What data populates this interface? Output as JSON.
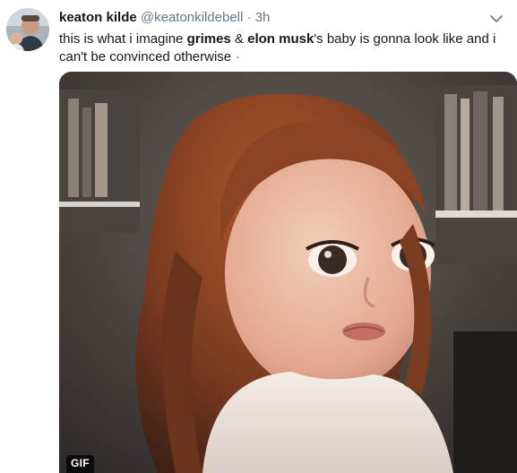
{
  "tweet": {
    "author_name": "keaton kilde",
    "author_handle": "@keatonkildebell",
    "separator": "·",
    "timestamp": "3h",
    "text_parts": {
      "p1": "this is what i imagine ",
      "bold1": "grimes",
      "p2": " & ",
      "bold2": "elon musk",
      "p3": "'s baby is gonna look like and i can't be convinced otherwise ",
      "trailing": "·"
    },
    "media": {
      "badge": "GIF",
      "description_icon": "gif-media"
    }
  },
  "icons": {
    "menu": "chevron-down-icon",
    "avatar": "avatar"
  },
  "colors": {
    "text_primary": "#14171a",
    "text_secondary": "#657786"
  }
}
